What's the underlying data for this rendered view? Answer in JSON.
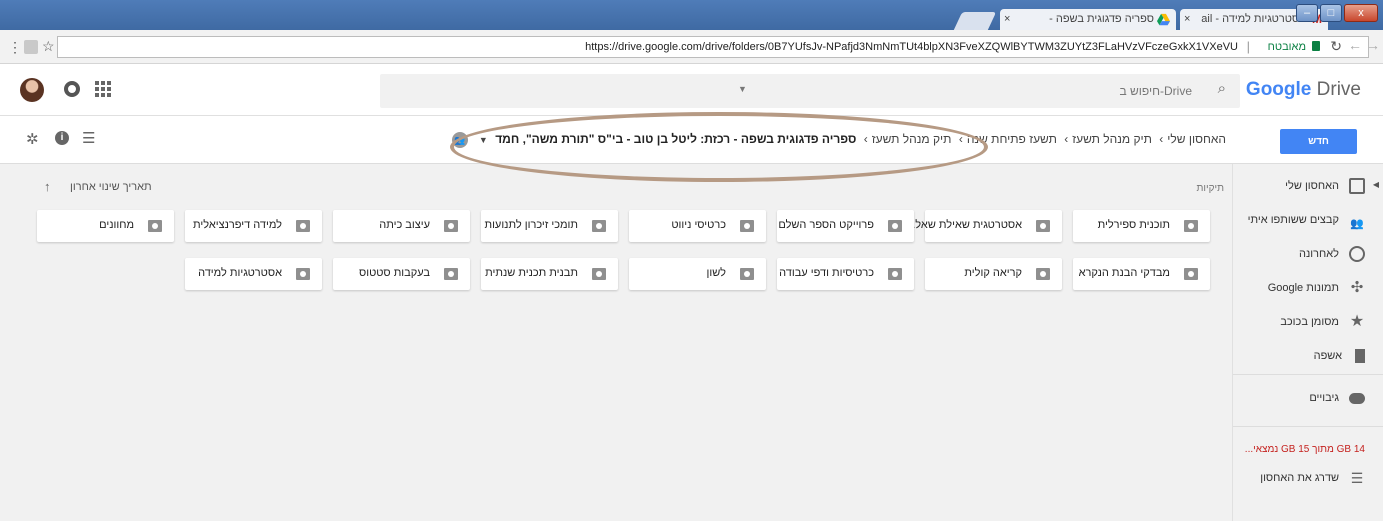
{
  "browser": {
    "tabs": [
      {
        "title": "אסטרטגיות למידה - ail",
        "close": "×"
      },
      {
        "title": "ספריה פדגוגית בשפה -",
        "close": "×"
      }
    ],
    "url": "https://drive.google.com/drive/folders/0B7YUfsJv-NPafjd3NmNmTUt4blpXN3FveXZQWlBYTWM3ZUYtZ3FLaHVzVFczeGxkX1VXeVU",
    "secure_label": "מאובטח",
    "window_buttons": {
      "minimize": "–",
      "maximize": "□",
      "close": "x"
    }
  },
  "drive": {
    "logo_google": "Google",
    "logo_drive": "Drive",
    "search_placeholder": "חיפוש ב-Drive",
    "new_button": "חדש",
    "breadcrumb": [
      "האחסון שלי",
      "תיק מנהל תשעז",
      "תשעז פתיחת שנה",
      "תיק מנהל תשעז",
      "ספריה פדגוגית בשפה - רכזת: ליטל בן טוב - בי\"ס \"תורת משה\", חמד"
    ],
    "sort_label": "תאריך שינוי אחרון",
    "folders_section_label": "תיקיות",
    "folders_row1": [
      "תוכנית ספירלית",
      "אסטרטגית שאילת שאל...",
      "פרוייקט הספר השלם",
      "כרטיסי ניווט",
      "תומכי זיכרון לתנועות",
      "עיצוב כיתה",
      "למידה דיפרנציאלית",
      "מחוונים"
    ],
    "folders_row2": [
      "מבדקי הבנת הנקרא",
      "קריאה קולית",
      "כרטיסיות ודפי עבודה",
      "לשון",
      "תבנית תכנית שנתית",
      "בעקבות סטטוס",
      "אסטרטגיות למידה"
    ]
  },
  "sidebar": {
    "items": [
      {
        "label": "האחסון שלי",
        "icon": "drive-icon"
      },
      {
        "label": "קבצים ששותפו איתי",
        "icon": "people-icon"
      },
      {
        "label": "לאחרונה",
        "icon": "clock-icon"
      },
      {
        "label": "תמונות Google",
        "icon": "pinwheel-icon"
      },
      {
        "label": "מסומן בכוכב",
        "icon": "star-icon"
      },
      {
        "label": "אשפה",
        "icon": "trash-icon"
      },
      {
        "label": "גיבויים",
        "icon": "cloud-icon"
      }
    ],
    "storage": "14 GB מתוך 15 GB נמצאי...",
    "upgrade": "שדרג את האחסון"
  }
}
